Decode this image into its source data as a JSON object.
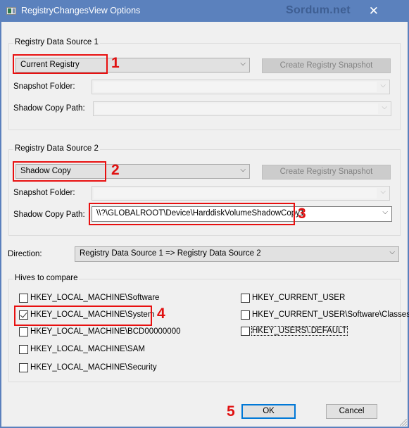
{
  "window": {
    "title": "RegistryChangesView Options",
    "watermark": "Sordum.net",
    "close_glyph": "✕"
  },
  "source1": {
    "group_label": "Registry Data Source 1",
    "type_value": "Current Registry",
    "create_snapshot_label": "Create Registry Snapshot",
    "snapshot_folder_label": "Snapshot Folder:",
    "snapshot_folder_value": "",
    "shadow_copy_label": "Shadow Copy Path:",
    "shadow_copy_value": ""
  },
  "source2": {
    "group_label": "Registry Data Source 2",
    "type_value": "Shadow Copy",
    "create_snapshot_label": "Create Registry Snapshot",
    "snapshot_folder_label": "Snapshot Folder:",
    "snapshot_folder_value": "",
    "shadow_copy_label": "Shadow Copy Path:",
    "shadow_copy_value": "\\\\?\\GLOBALROOT\\Device\\HarddiskVolumeShadowCopy1"
  },
  "direction": {
    "label": "Direction:",
    "value": "Registry Data Source 1 => Registry Data Source 2"
  },
  "hives": {
    "group_label": "Hives to compare",
    "left": [
      {
        "label": "HKEY_LOCAL_MACHINE\\Software",
        "checked": false
      },
      {
        "label": "HKEY_LOCAL_MACHINE\\System",
        "checked": true
      },
      {
        "label": "HKEY_LOCAL_MACHINE\\BCD00000000",
        "checked": false
      },
      {
        "label": "HKEY_LOCAL_MACHINE\\SAM",
        "checked": false
      },
      {
        "label": "HKEY_LOCAL_MACHINE\\Security",
        "checked": false
      }
    ],
    "right": [
      {
        "label": "HKEY_CURRENT_USER",
        "checked": false
      },
      {
        "label": "HKEY_CURRENT_USER\\Software\\Classes",
        "checked": false
      },
      {
        "label": "HKEY_USERS\\.DEFAULT",
        "checked": false
      }
    ]
  },
  "buttons": {
    "ok": "OK",
    "cancel": "Cancel"
  },
  "annotations": [
    "1",
    "2",
    "3",
    "4",
    "5"
  ],
  "chevron_glyph": "⌵",
  "colors": {
    "titlebar": "#5b81bd",
    "annotation_red": "#e81010",
    "default_button_border": "#0078d7"
  }
}
